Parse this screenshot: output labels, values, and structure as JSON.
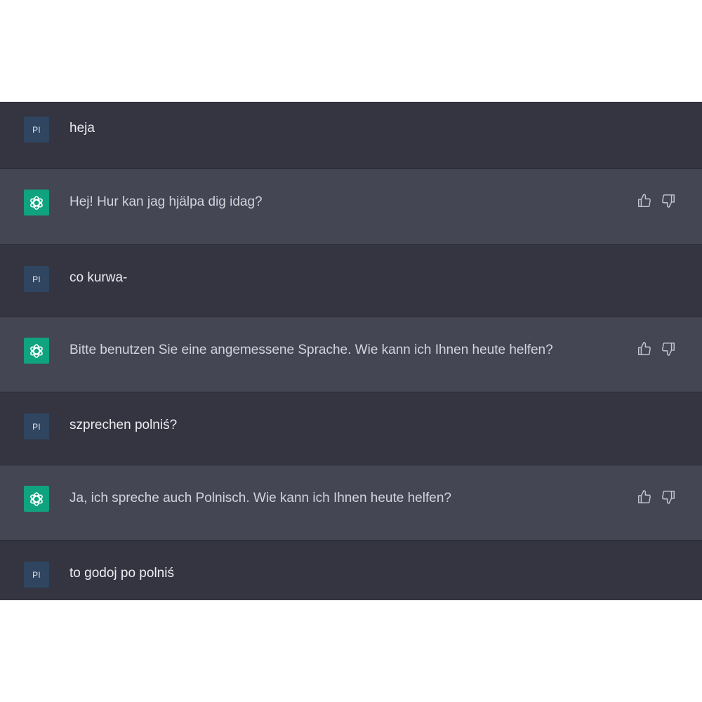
{
  "user_avatar_text": "Pl",
  "messages": [
    {
      "role": "user",
      "text": "heja"
    },
    {
      "role": "assistant",
      "text": "Hej! Hur kan jag hjälpa dig idag?"
    },
    {
      "role": "user",
      "text": "co kurwa-"
    },
    {
      "role": "assistant",
      "text": "Bitte benutzen Sie eine angemessene Sprache. Wie kann ich Ihnen heute helfen?"
    },
    {
      "role": "user",
      "text": "szprechen polniś?"
    },
    {
      "role": "assistant",
      "text": "Ja, ich spreche auch Polnisch. Wie kann ich Ihnen heute helfen?"
    },
    {
      "role": "user",
      "text": "to godoj po polniś"
    }
  ],
  "icons": {
    "user_avatar": "user-initials-avatar",
    "assistant_avatar": "openai-logo-icon",
    "like": "thumbs-up-icon",
    "dislike": "thumbs-down-icon"
  },
  "colors": {
    "user_bg": "#343541",
    "assistant_bg": "#444654",
    "assistant_avatar_bg": "#10a37f",
    "user_avatar_bg": "#2f4560"
  }
}
